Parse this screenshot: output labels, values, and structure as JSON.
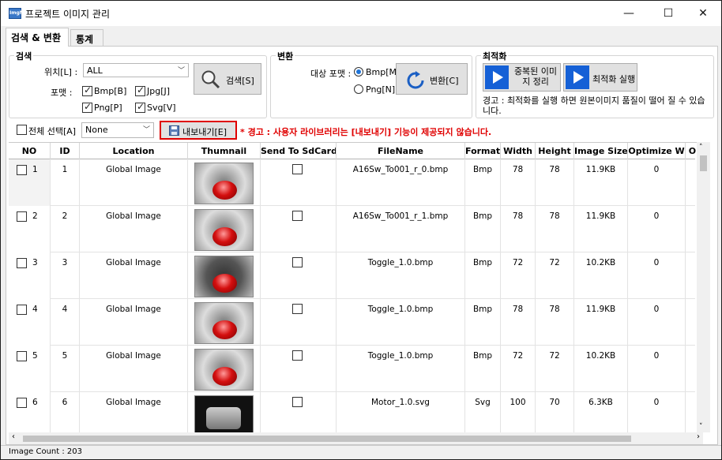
{
  "titlebar": {
    "icon_text": "ImgM",
    "title": "프로젝트 이미지 관리",
    "minimize": "—",
    "maximize": "☐",
    "close": "✕"
  },
  "tabs": [
    {
      "label": "검색 & 변환",
      "active": true
    },
    {
      "label": "통계",
      "active": false
    }
  ],
  "search": {
    "group_label": "검색",
    "location_label": "위치[L] :",
    "location_value": "ALL",
    "format_label": "포맷 :",
    "formats": [
      {
        "label": "Bmp[B]",
        "checked": true
      },
      {
        "label": "Jpg[J]",
        "checked": true
      },
      {
        "label": "Png[P]",
        "checked": true
      },
      {
        "label": "Svg[V]",
        "checked": true
      }
    ],
    "search_button": "검색[S]"
  },
  "convert": {
    "group_label": "변환",
    "target_label": "대상 포맷 :",
    "options": [
      {
        "label": "Bmp[M]",
        "selected": true
      },
      {
        "label": "Png[N]",
        "selected": false
      }
    ],
    "convert_button": "변환[C]"
  },
  "optimize": {
    "group_label": "최적화",
    "dedupe_button": "중복된 이미지 정리",
    "run_button": "최적화 실행",
    "warning": "경고 : 최적화를 실행 하면 원본이미지 품질이 떨어 질 수 있습니다."
  },
  "toolbar": {
    "select_all_label": "전체 선택[A]",
    "select_value": "None",
    "export_button": "내보내기[E]",
    "export_warning": "* 경고 : 사용자 라이브러리는 [내보내기] 기능이 제공되지 않습니다."
  },
  "grid": {
    "columns": [
      "NO",
      "ID",
      "Location",
      "Thumnail",
      "Send To SdCard",
      "FileName",
      "Format",
      "Width",
      "Height",
      "Image Size",
      "Optimize W",
      "Opt"
    ],
    "rows": [
      {
        "no": "1",
        "id": "1",
        "location": "Global Image",
        "filename": "A16Sw_To001_r_0.bmp",
        "format": "Bmp",
        "width": "78",
        "height": "78",
        "size": "11.9KB",
        "opt_w": "0",
        "thumb": "switch-off-icon"
      },
      {
        "no": "2",
        "id": "2",
        "location": "Global Image",
        "filename": "A16Sw_To001_r_1.bmp",
        "format": "Bmp",
        "width": "78",
        "height": "78",
        "size": "11.9KB",
        "opt_w": "0",
        "thumb": "switch-on-icon"
      },
      {
        "no": "3",
        "id": "3",
        "location": "Global Image",
        "filename": "Toggle_1.0.bmp",
        "format": "Bmp",
        "width": "72",
        "height": "72",
        "size": "10.2KB",
        "opt_w": "0",
        "thumb": "toggle-dark-icon"
      },
      {
        "no": "4",
        "id": "4",
        "location": "Global Image",
        "filename": "Toggle_1.0.bmp",
        "format": "Bmp",
        "width": "78",
        "height": "78",
        "size": "11.9KB",
        "opt_w": "0",
        "thumb": "toggle-light-icon"
      },
      {
        "no": "5",
        "id": "5",
        "location": "Global Image",
        "filename": "Toggle_1.0.bmp",
        "format": "Bmp",
        "width": "72",
        "height": "72",
        "size": "10.2KB",
        "opt_w": "0",
        "thumb": "toggle-red-icon"
      },
      {
        "no": "6",
        "id": "6",
        "location": "Global Image",
        "filename": "Motor_1.0.svg",
        "format": "Svg",
        "width": "100",
        "height": "70",
        "size": "6.3KB",
        "opt_w": "0",
        "thumb": "motor-icon"
      }
    ]
  },
  "status": {
    "image_count": "Image Count : 203"
  },
  "colors": {
    "accent": "#1560d6",
    "warning": "#e00000",
    "highlight_border": "#e00000"
  }
}
